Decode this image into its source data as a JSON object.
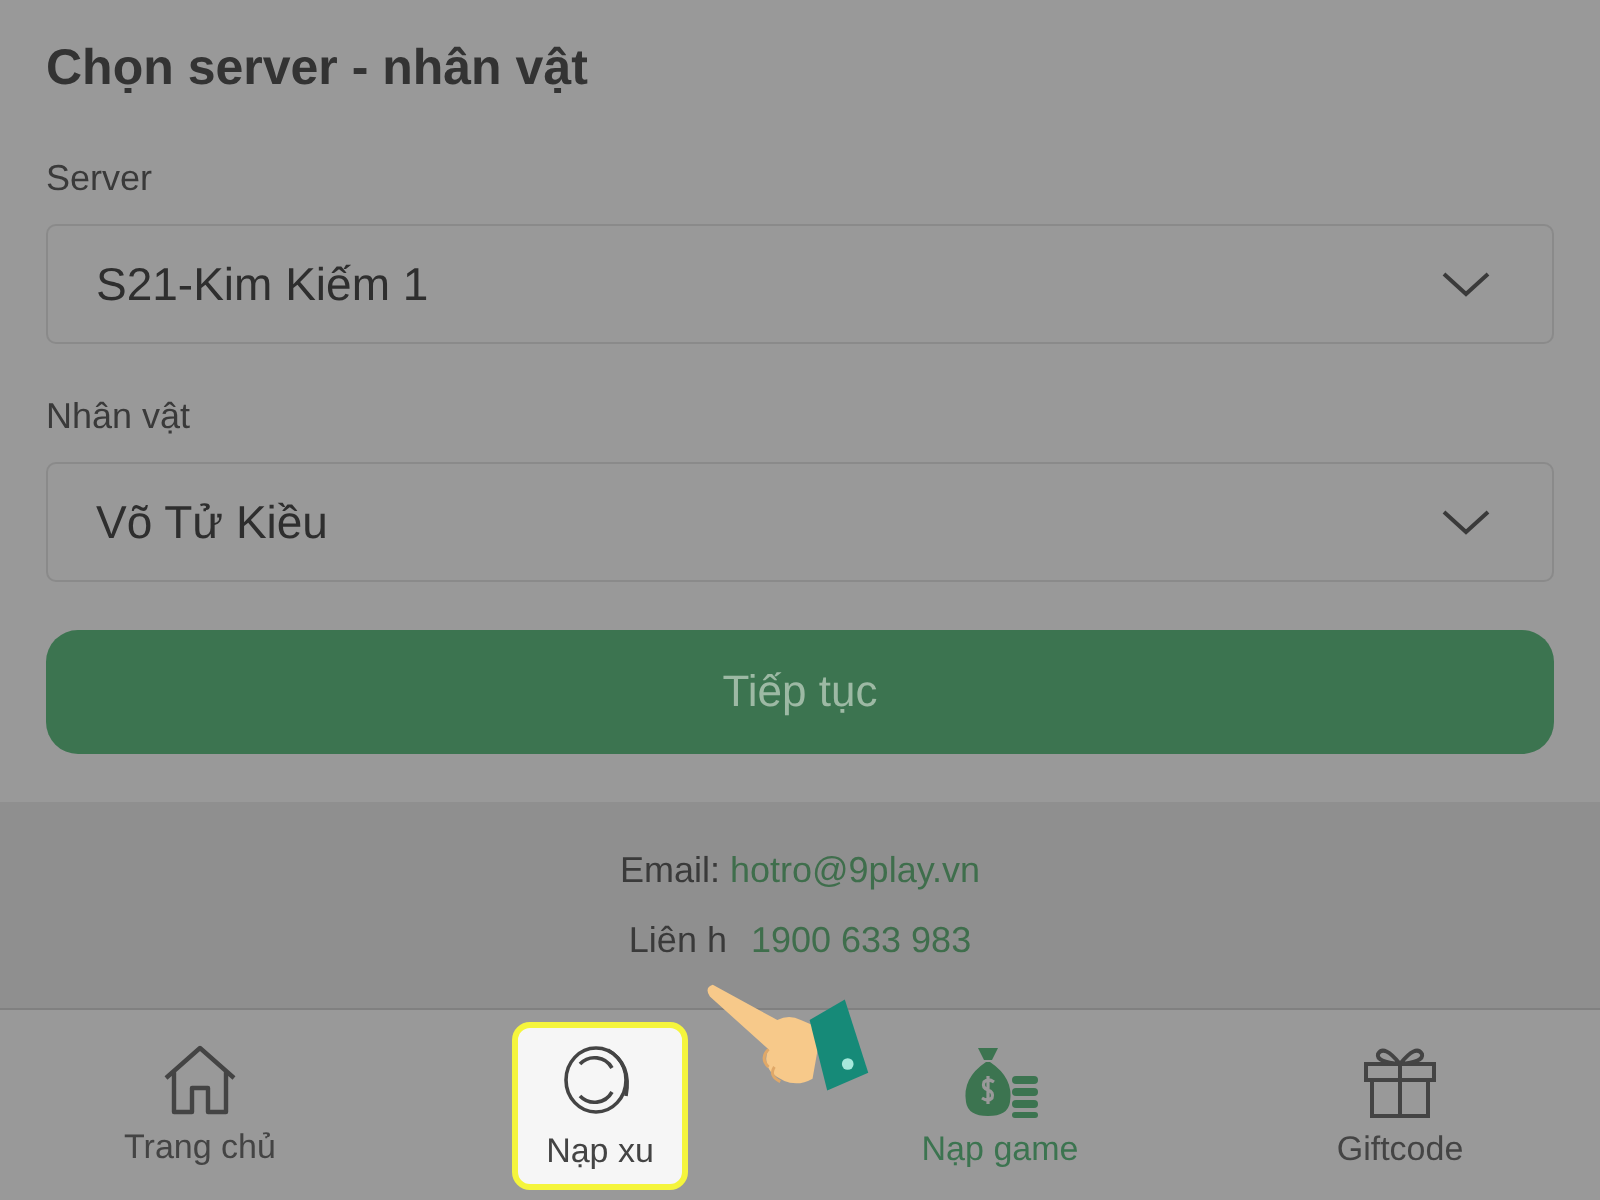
{
  "title": "Chọn server - nhân vật",
  "fields": [
    {
      "label": "Server",
      "value": "S21-Kim Kiếm 1"
    },
    {
      "label": "Nhân vật",
      "value": "Võ Tử Kiều"
    }
  ],
  "submit_button": {
    "label": "Tiếp tục"
  },
  "footer": {
    "email_label": "Email:",
    "email": "hotro@9play.vn",
    "phone_label": "Liên h",
    "phone": "1900 633 983"
  },
  "nav": [
    {
      "label": "Trang chủ",
      "selected": false,
      "highlighted": false
    },
    {
      "label": "Nạp xu",
      "selected": false,
      "highlighted": true
    },
    {
      "label": "Nạp game",
      "selected": true,
      "highlighted": false
    },
    {
      "label": "Giftcode",
      "selected": false,
      "highlighted": false
    }
  ]
}
